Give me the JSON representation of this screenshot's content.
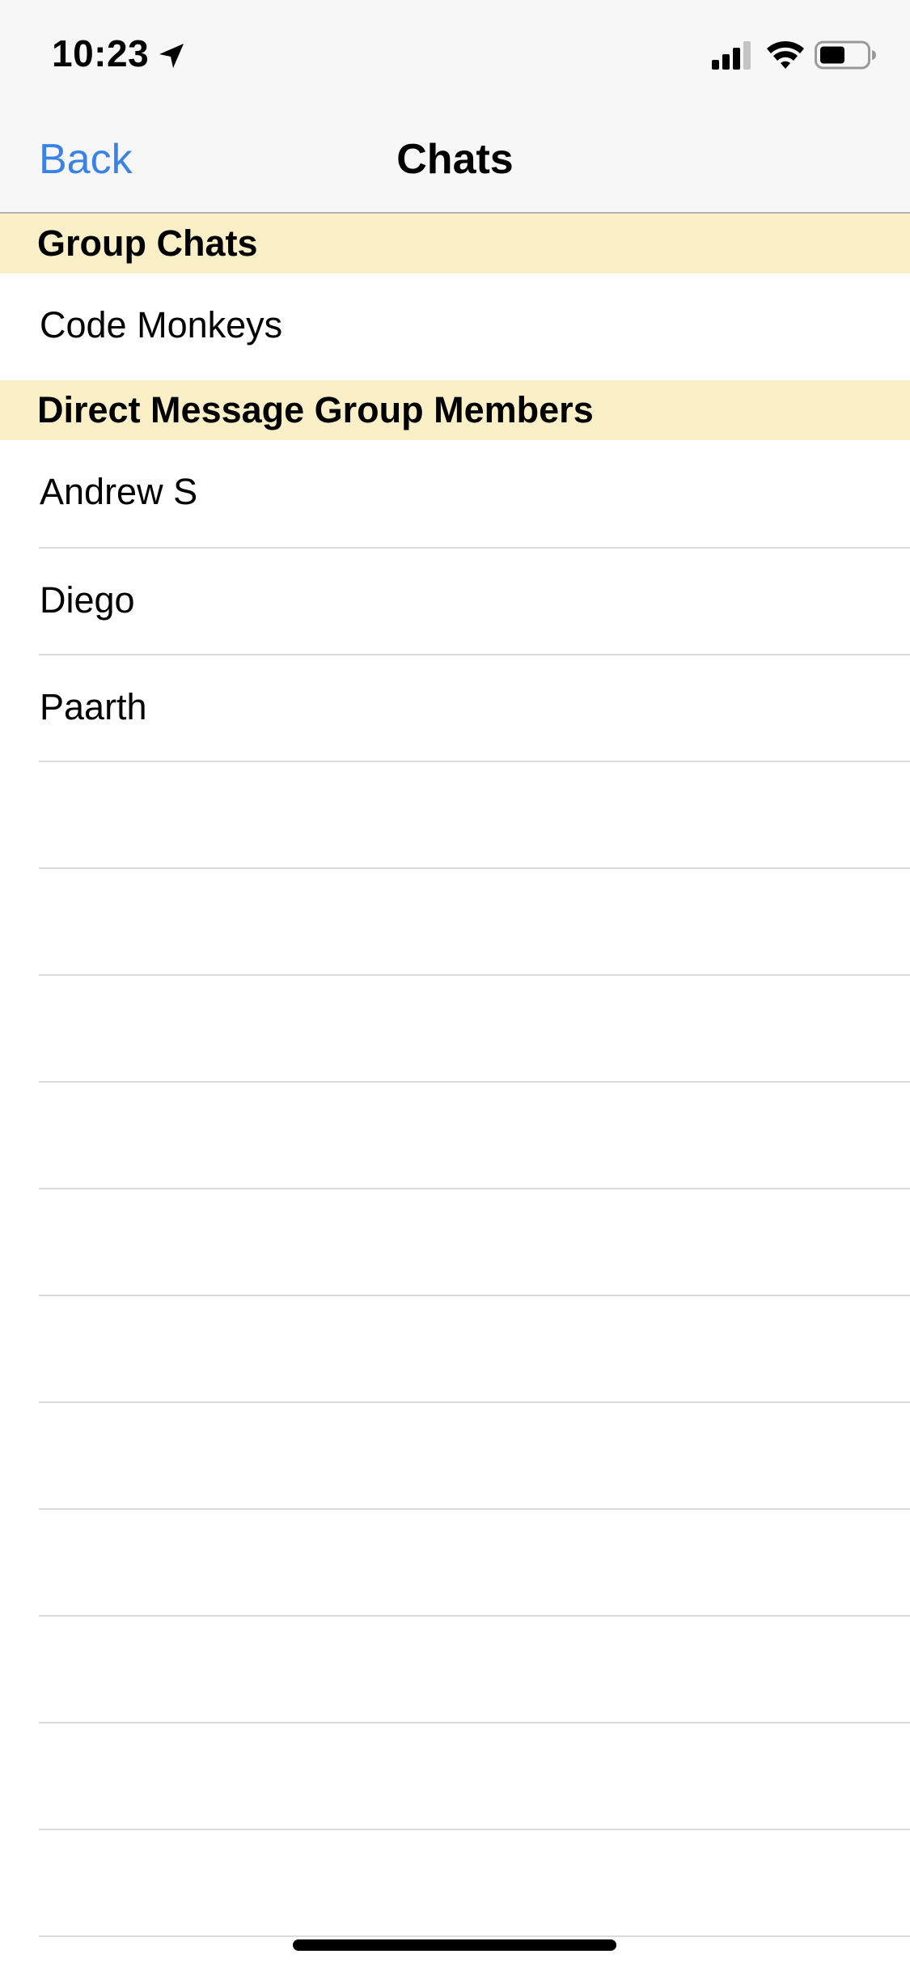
{
  "status_bar": {
    "time": "10:23",
    "location_icon": "location-arrow-icon",
    "signal_icon": "cellular-signal-icon",
    "wifi_icon": "wifi-icon",
    "battery_icon": "battery-icon"
  },
  "nav": {
    "back_label": "Back",
    "title": "Chats"
  },
  "sections": [
    {
      "header": "Group Chats",
      "rows": [
        "Code Monkeys"
      ]
    },
    {
      "header": "Direct Message Group Members",
      "rows": [
        "Andrew S",
        "Diego",
        "Paarth"
      ]
    }
  ],
  "colors": {
    "accent": "#3a82e6",
    "section_header_bg": "#faefc6",
    "bar_bg": "#f7f7f7",
    "separator": "#dcdcdc"
  }
}
